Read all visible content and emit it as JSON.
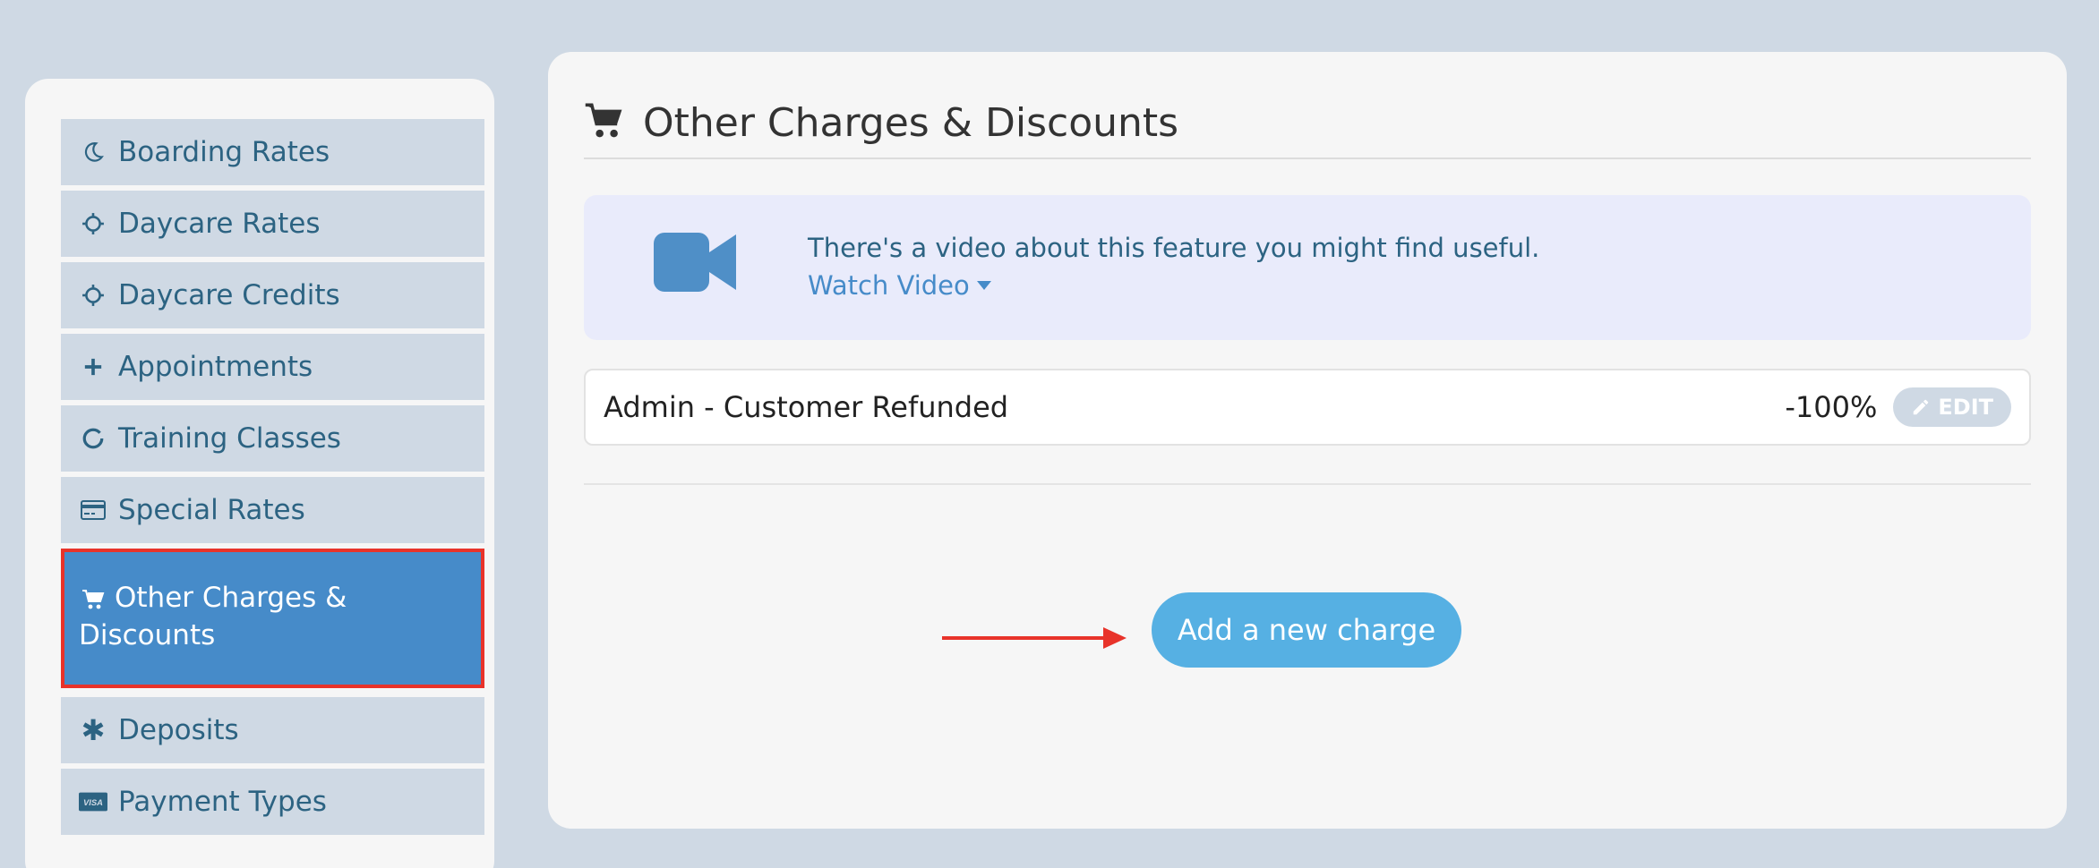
{
  "sidebar": {
    "items": [
      {
        "label": "Boarding Rates",
        "icon": "moon-icon"
      },
      {
        "label": "Daycare Rates",
        "icon": "sun-icon"
      },
      {
        "label": "Daycare Credits",
        "icon": "sun-icon"
      },
      {
        "label": "Appointments",
        "icon": "plus-icon"
      },
      {
        "label": "Training Classes",
        "icon": "circle-icon"
      },
      {
        "label": "Special Rates",
        "icon": "credit-card-icon"
      },
      {
        "label": "Other Charges & Discounts",
        "icon": "cart-icon",
        "active": true
      },
      {
        "label": "Deposits",
        "icon": "asterisk-icon"
      },
      {
        "label": "Payment Types",
        "icon": "visa-icon"
      }
    ]
  },
  "main": {
    "title": "Other Charges & Discounts",
    "video": {
      "message": "There's a video about this feature you might find useful.",
      "link": "Watch Video"
    },
    "charges": [
      {
        "name": "Admin - Customer Refunded",
        "value": "-100%",
        "edit_label": "EDIT"
      }
    ],
    "add_button": "Add a new charge"
  },
  "colors": {
    "accent": "#468bc9",
    "button": "#56b0e3",
    "highlight": "#e8332a"
  }
}
